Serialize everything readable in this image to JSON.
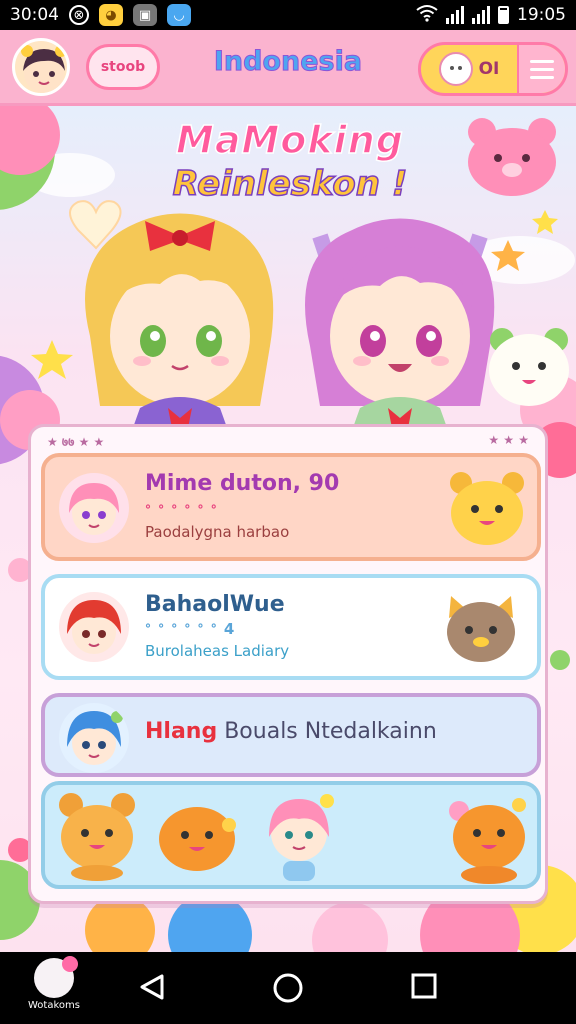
{
  "status_bar": {
    "time_left": "30:04",
    "time_right": "19:05"
  },
  "header": {
    "pill_label": "stoob",
    "title": "Indonesia",
    "counter_label": "OI"
  },
  "headline": {
    "line1": "MaMoking",
    "line2": "Reinleskon !"
  },
  "panel": {
    "left_marks": "★ ७७ ★ ★",
    "right_marks": "★ ★ ★"
  },
  "cards": [
    {
      "title": "Mime duton, 90",
      "subtitle": "ᐤ ᐤ ᐤ ᐤ ᐤ ᐤ",
      "description": "Paodalygna harbao"
    },
    {
      "title": "BahaolWue",
      "subtitle": "ᐤ ᐤ ᐤ ᐤ ᐤ ᐤ 4",
      "description": "Burolaheas Ladiary"
    },
    {
      "title_accent": "Hlang",
      "title_rest": " Bouals Ntedalkainn"
    }
  ],
  "nav": {
    "app_label": "Wotakoms"
  },
  "colors": {
    "header_bg": "#fbb3cf",
    "accent_pink": "#ff5b9d",
    "accent_yellow": "#ffc43b",
    "card1": "#ffd6c6",
    "card2": "#ffffff",
    "card3": "#ddeafb",
    "card4": "#ccecfb"
  }
}
